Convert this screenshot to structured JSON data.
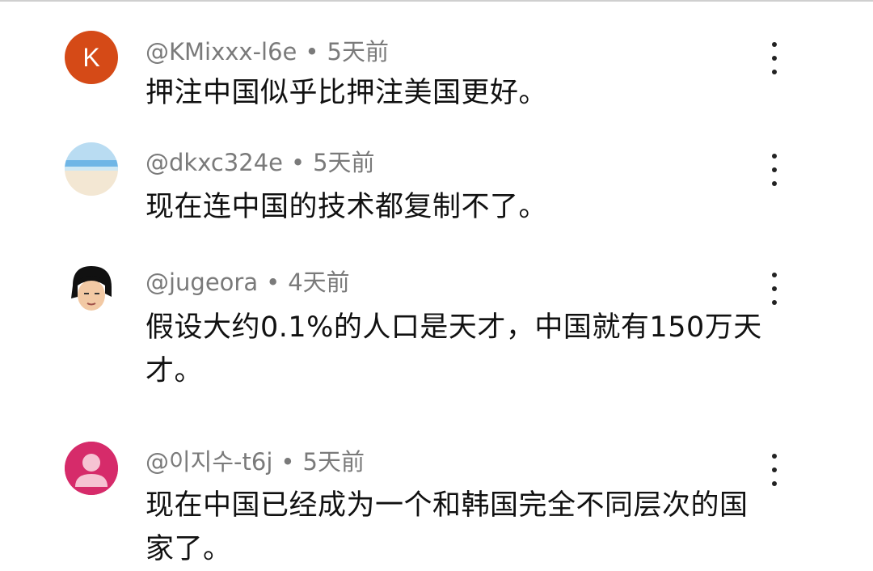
{
  "comments": [
    {
      "author": "@KMixxx-l6e",
      "separator": "•",
      "time": "5天前",
      "text": "押注中国似乎比押注美国更好。",
      "avatar": {
        "type": "letter",
        "letter": "K",
        "color": "#d54a17"
      }
    },
    {
      "author": "@dkxc324e",
      "separator": "•",
      "time": "5天前",
      "text": "现在连中国的技术都复制不了。",
      "avatar": {
        "type": "image",
        "description_icon": "beach-photo-icon"
      }
    },
    {
      "author": "@jugeora",
      "separator": "•",
      "time": "4天前",
      "text": "假设大约0.1%的人口是天才，中国就有150万天才。",
      "avatar": {
        "type": "image",
        "description_icon": "cartoon-face-icon"
      }
    },
    {
      "author": "@이지수-t6j",
      "separator": "•",
      "time": "5天前",
      "text": "现在中国已经成为一个和韩国完全不同层次的国家了。",
      "avatar": {
        "type": "default",
        "description_icon": "default-user-icon",
        "color": "#d62b6a"
      }
    }
  ]
}
